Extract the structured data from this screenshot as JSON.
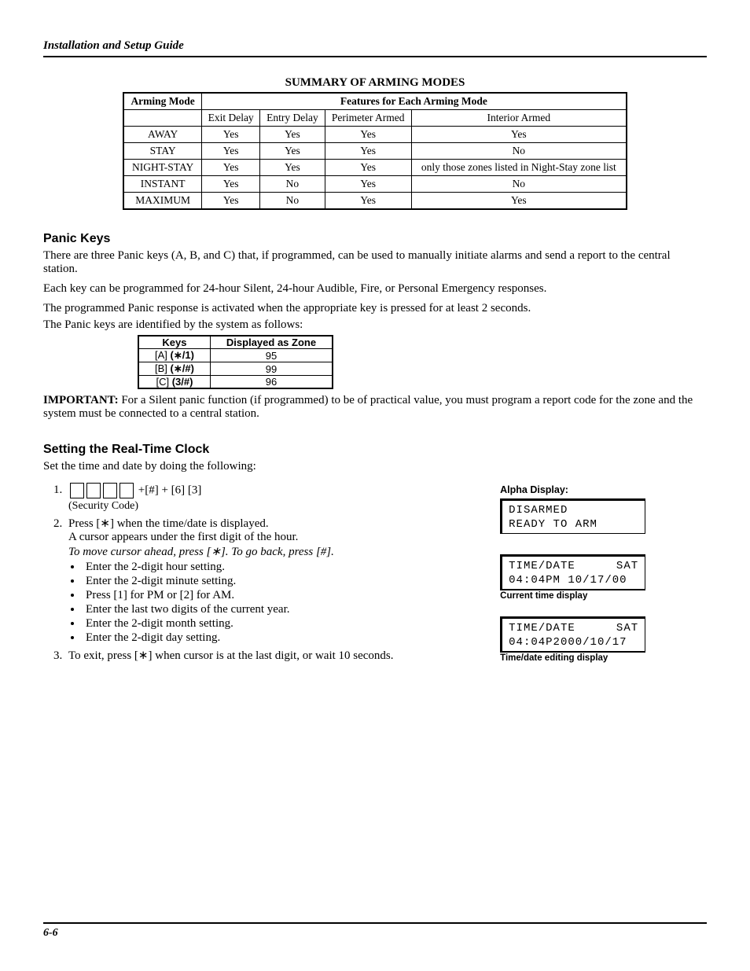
{
  "header": "Installation and Setup Guide",
  "footer_page": "6-6",
  "arming_table": {
    "title": "SUMMARY OF ARMING MODES",
    "col_mode": "Arming Mode",
    "col_features": "Features for Each Arming Mode",
    "sub_heads": [
      "Exit Delay",
      "Entry Delay",
      "Perimeter Armed",
      "Interior Armed"
    ],
    "rows": [
      {
        "mode": "AWAY",
        "cells": [
          "Yes",
          "Yes",
          "Yes",
          "Yes"
        ]
      },
      {
        "mode": "STAY",
        "cells": [
          "Yes",
          "Yes",
          "Yes",
          "No"
        ]
      },
      {
        "mode": "NIGHT-STAY",
        "cells": [
          "Yes",
          "Yes",
          "Yes",
          "only those zones listed in Night-Stay zone list"
        ]
      },
      {
        "mode": "INSTANT",
        "cells": [
          "Yes",
          "No",
          "Yes",
          "No"
        ]
      },
      {
        "mode": "MAXIMUM",
        "cells": [
          "Yes",
          "No",
          "Yes",
          "Yes"
        ]
      }
    ]
  },
  "panic": {
    "heading": "Panic Keys",
    "p1": "There are three Panic keys (A, B, and C) that, if programmed, can be used to manually initiate alarms and send a report to the central station.",
    "p2": "Each key can be programmed for 24-hour Silent, 24-hour Audible, Fire, or Personal Emergency responses.",
    "p3": "The programmed Panic response is activated when the appropriate key is pressed for at least 2 seconds.",
    "p4": "The Panic keys are identified by the system as follows:",
    "table": {
      "head_keys": "Keys",
      "head_zone": "Displayed as Zone",
      "rows": [
        {
          "k_plain": "[A] ",
          "k_bold": "(∗/1)",
          "z": "95"
        },
        {
          "k_plain": "[B] ",
          "k_bold": "(∗/#)",
          "z": "99"
        },
        {
          "k_plain": "[C] ",
          "k_bold": "(3/#)",
          "z": "96"
        }
      ]
    },
    "important_label": "IMPORTANT:",
    "important_text": "  For a Silent panic function (if programmed) to be of practical value, you must program a report code for the zone and the system must be connected to a central station."
  },
  "clock": {
    "heading": "Setting the Real-Time Clock",
    "intro": "Set the time and date by doing the following:",
    "step1_suffix": " +[#] +  [6] [3]",
    "sec_code": "(Security Code)",
    "step2_line1": "Press [∗] when the time/date is displayed.",
    "step2_line2": "A cursor appears under the first digit of the hour.",
    "step2_line3": "To move cursor ahead, press [∗]. To go back, press [#].",
    "bullets": [
      "Enter the 2-digit hour setting.",
      "Enter the 2-digit minute setting.",
      "Press [1] for PM or [2] for AM.",
      "Enter the last two digits of the current year.",
      "Enter the 2-digit month setting.",
      "Enter the 2-digit day setting."
    ],
    "step3": "To exit, press [∗] when cursor is at the last digit, or wait 10 seconds."
  },
  "displays": {
    "alpha_label": "Alpha Display:",
    "lcd1_l1": "DISARMED",
    "lcd1_l2": "READY TO ARM",
    "lcd2_l1a": "TIME/DATE",
    "lcd2_l1b": "SAT",
    "lcd2_l2": "04:04PM 10/17/00",
    "cap2": "Current time display",
    "lcd3_l1a": "TIME/DATE",
    "lcd3_l1b": "SAT",
    "lcd3_l2": "04:04P2000/10/17",
    "cap3": "Time/date editing display"
  }
}
